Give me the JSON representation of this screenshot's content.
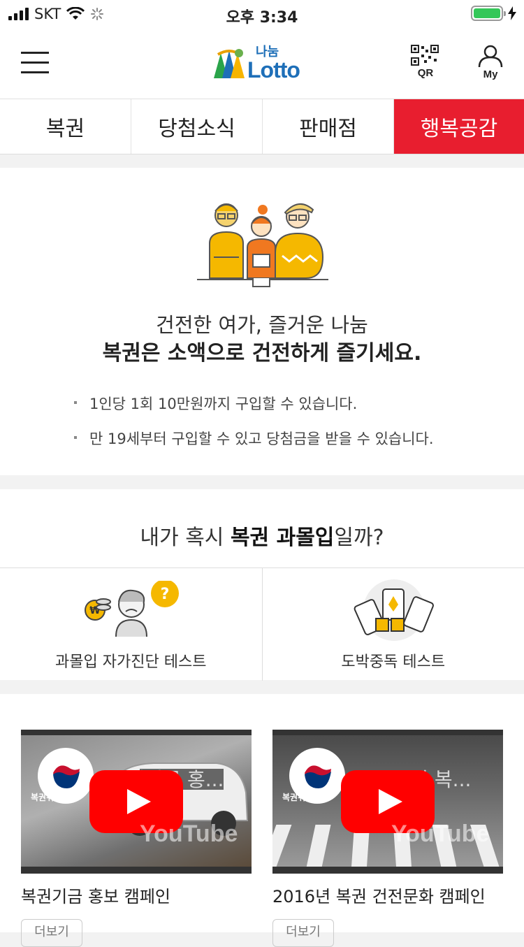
{
  "status_bar": {
    "carrier": "SKT",
    "time": "오후 3:34"
  },
  "header": {
    "logo_small": "나눔",
    "logo_big": "Lotto",
    "qr_label": "QR",
    "my_label": "My"
  },
  "tabs": [
    {
      "label": "복권"
    },
    {
      "label": "당첨소식"
    },
    {
      "label": "판매점"
    },
    {
      "label": "행복공감",
      "active": true
    }
  ],
  "intro": {
    "line1": "건전한 여가, 즐거운 나눔",
    "line2": "복권은 소액으로 건전하게 즐기세요.",
    "bullets": [
      "1인당 1회 10만원까지 구입할 수 있습니다.",
      "만 19세부터 구입할 수 있고 당첨금을 받을 수 있습니다."
    ]
  },
  "addiction": {
    "title_pre": "내가 혹시 ",
    "title_bold": "복권 과몰입",
    "title_post": "일까?",
    "items": [
      {
        "label": "과몰입 자가진단 테스트",
        "icon": "self-diagnosis-icon"
      },
      {
        "label": "도박중독 테스트",
        "icon": "gambling-cards-icon"
      }
    ]
  },
  "videos": [
    {
      "overlay_title": "복권기금 홍...",
      "seal_text": "복권위원회",
      "caption": "복권기금 홍보 캠페인",
      "tag": "더보기",
      "brand": "YouTube"
    },
    {
      "overlay_title": "2016년 복...",
      "seal_text": "복권위원회",
      "caption": "2016년 복권 건전문화 캠페인",
      "tag": "더보기",
      "brand": "YouTube"
    }
  ],
  "colors": {
    "accent": "#e81e2f",
    "logo_blue": "#1e6fb8",
    "play_red": "#ff0000"
  }
}
